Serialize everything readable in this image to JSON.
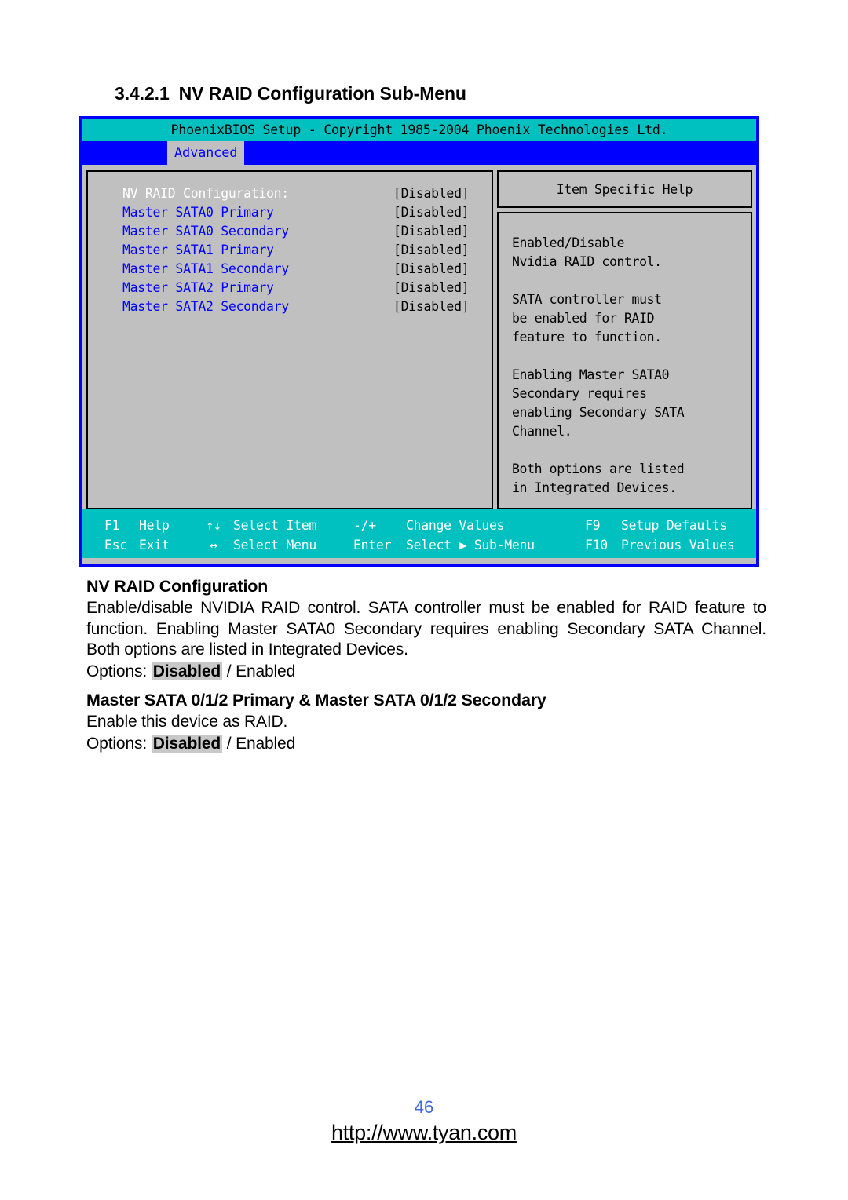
{
  "document": {
    "heading_number": "3.4.2.1",
    "heading_title": "NV RAID Configuration Sub-Menu"
  },
  "bios": {
    "titlebar": "PhoenixBIOS Setup - Copyright 1985-2004 Phoenix Technologies Ltd.",
    "active_tab": "Advanced",
    "settings": [
      {
        "label": "NV RAID Configuration:",
        "value": "[Disabled]",
        "selected": true
      },
      {
        "label": "Master SATA0 Primary",
        "value": "[Disabled]",
        "selected": false
      },
      {
        "label": "Master SATA0 Secondary",
        "value": "[Disabled]",
        "selected": false
      },
      {
        "label": "Master SATA1 Primary",
        "value": "[Disabled]",
        "selected": false
      },
      {
        "label": "Master SATA1 Secondary",
        "value": "[Disabled]",
        "selected": false
      },
      {
        "label": "Master SATA2 Primary",
        "value": "[Disabled]",
        "selected": false
      },
      {
        "label": "Master SATA2 Secondary",
        "value": "[Disabled]",
        "selected": false
      }
    ],
    "help": {
      "title": "Item Specific Help",
      "paragraphs": [
        "Enabled/Disable\nNvidia RAID control.",
        "SATA controller must\nbe enabled for RAID\nfeature to function.",
        "Enabling Master SATA0\nSecondary requires\nenabling Secondary SATA\nChannel.",
        "Both options are listed\nin Integrated Devices."
      ]
    },
    "footer_keys": {
      "row1": {
        "key1": "F1",
        "action1": "Help",
        "key2": "↑↓",
        "action2": "Select Item",
        "key3": "-/+",
        "action3": "Change Values",
        "key4": "F9",
        "action4": "Setup Defaults"
      },
      "row2": {
        "key1": "Esc",
        "action1": "Exit",
        "key2": "↔",
        "action2": "Select Menu",
        "key3": "Enter",
        "action3": "Select ▶ Sub-Menu",
        "key4": "F10",
        "action4": "Previous Values"
      }
    },
    "colors": {
      "titlebar_bg": "#00c0c0",
      "menubar_bg": "#0000ff",
      "panel_bg": "#c0c0c0",
      "border": "#0000ff",
      "link_text": "#0000ff",
      "selected_text": "#ffffff"
    }
  },
  "sections": [
    {
      "title": "NV RAID Configuration",
      "body": "Enable/disable NVIDIA RAID control.  SATA controller must be enabled for RAID feature to function.   Enabling Master SATA0 Secondary requires enabling Secondary SATA Channel.  Both options are listed in Integrated Devices.",
      "options_prefix": "Options: ",
      "options_default": "Disabled",
      "options_rest": " / Enabled"
    },
    {
      "title": "Master SATA 0/1/2 Primary & Master SATA 0/1/2 Secondary",
      "body": "Enable this device as RAID.",
      "options_prefix": "Options: ",
      "options_default": "Disabled",
      "options_rest": " / Enabled"
    }
  ],
  "page_footer": {
    "page_number": "46",
    "url": "http://www.tyan.com"
  }
}
